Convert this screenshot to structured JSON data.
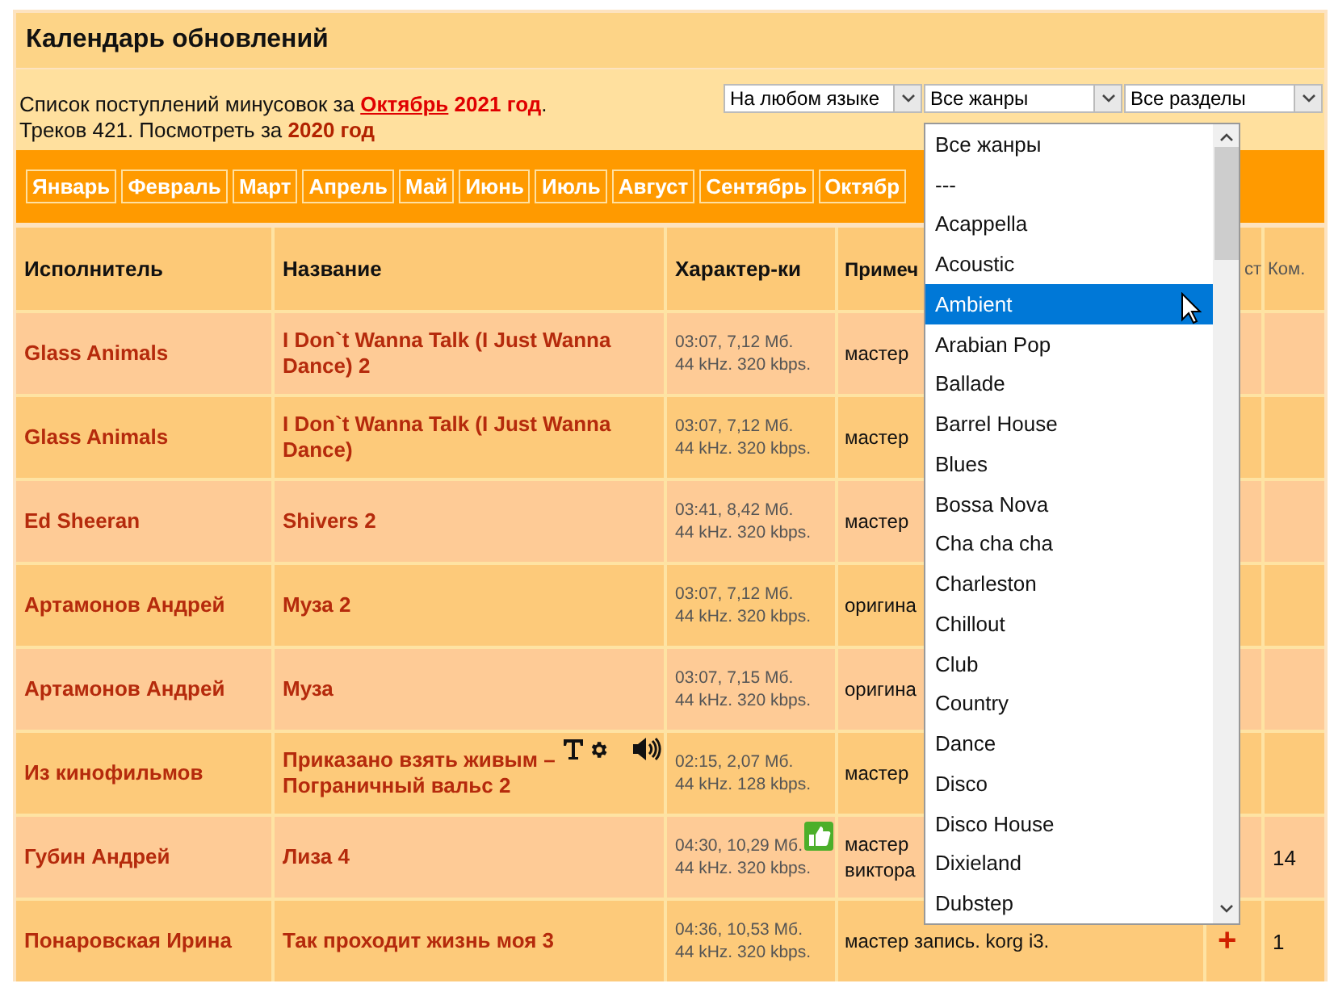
{
  "title": "Календарь обновлений",
  "info": {
    "line1_prefix": "Список поступлений минусовок за",
    "month_link": "Октябрь",
    "year": "2021 год",
    "line1_suffix": ".",
    "line2_prefix": "Треков 421. Посмотреть за",
    "year_link": "2020 год"
  },
  "filters": [
    {
      "value": "На любом языке"
    },
    {
      "value": "Все жанры"
    },
    {
      "value": "Все разделы"
    }
  ],
  "months": [
    "Январь",
    "Февраль",
    "Март",
    "Апрель",
    "Май",
    "Июнь",
    "Июль",
    "Август",
    "Сентябрь",
    "Октябр"
  ],
  "columns": [
    "Исполнитель",
    "Название",
    "Характер-ки",
    "Примеч",
    "ст",
    "Ком."
  ],
  "rows": [
    {
      "artist": "Glass Animals",
      "title": "I Don`t Wanna Talk (I Just Wanna Dance) 2",
      "chars": [
        "03:07, 7,12 Мб.",
        "44 kHz. 320 kbps."
      ],
      "note": [
        "мастер"
      ],
      "tools": false,
      "liked": false
    },
    {
      "artist": "Glass Animals",
      "title": "I Don`t Wanna Talk (I Just Wanna Dance)",
      "chars": [
        "03:07, 7,12 Мб.",
        "44 kHz. 320 kbps."
      ],
      "note": [
        "мастер"
      ],
      "tools": false,
      "liked": false
    },
    {
      "artist": "Ed Sheeran",
      "title": "Shivers 2",
      "chars": [
        "03:41, 8,42 Мб.",
        "44 kHz. 320 kbps."
      ],
      "note": [
        "мастер"
      ],
      "tools": false,
      "liked": false
    },
    {
      "artist": "Артамонов Андрей",
      "title": "Муза 2",
      "chars": [
        "03:07, 7,12 Мб.",
        "44 kHz. 320 kbps."
      ],
      "note": [
        "оригина"
      ],
      "tools": false,
      "liked": false
    },
    {
      "artist": "Артамонов Андрей",
      "title": "Муза",
      "chars": [
        "03:07, 7,15 Мб.",
        "44 kHz. 320 kbps."
      ],
      "note": [
        "оригина"
      ],
      "tools": false,
      "liked": false
    },
    {
      "artist": "Из кинофильмов",
      "title": "Приказано взять живым – Пограничный вальс 2",
      "chars": [
        "02:15, 2,07 Мб.",
        "44 kHz. 128 kbps."
      ],
      "note": [
        "мастер"
      ],
      "tools": true,
      "liked": false
    },
    {
      "artist": "Губин Андрей",
      "title": "Лиза 4",
      "chars": [
        "04:30, 10,29 Мб.",
        "44 kHz. 320 kbps."
      ],
      "note": [
        "мастер",
        "виктора"
      ],
      "tools": false,
      "liked": true,
      "comments": "14"
    },
    {
      "artist": "Понаровская Ирина",
      "title": "Так проходит жизнь моя 3",
      "chars": [
        "04:36, 10,53 Мб.",
        "44 kHz. 320 kbps."
      ],
      "note": [
        "мастер запись. korg i3."
      ],
      "tools": false,
      "liked": false,
      "add": "+",
      "comments": "1"
    }
  ],
  "genre_list": [
    {
      "label": "Все жанры",
      "selected": false
    },
    {
      "label": "---",
      "selected": false
    },
    {
      "label": "Acappella",
      "selected": false
    },
    {
      "label": "Acoustic",
      "selected": false
    },
    {
      "label": "Ambient",
      "selected": true
    },
    {
      "label": "Arabian Pop",
      "selected": false
    },
    {
      "label": "Ballade",
      "selected": false
    },
    {
      "label": "Barrel House",
      "selected": false
    },
    {
      "label": "Blues",
      "selected": false
    },
    {
      "label": "Bossa Nova",
      "selected": false
    },
    {
      "label": "Cha cha cha",
      "selected": false
    },
    {
      "label": "Charleston",
      "selected": false
    },
    {
      "label": "Chillout",
      "selected": false
    },
    {
      "label": "Club",
      "selected": false
    },
    {
      "label": "Country",
      "selected": false
    },
    {
      "label": "Dance",
      "selected": false
    },
    {
      "label": "Disco",
      "selected": false
    },
    {
      "label": "Disco House",
      "selected": false
    },
    {
      "label": "Dixieland",
      "selected": false
    },
    {
      "label": "Dubstep",
      "selected": false
    }
  ]
}
